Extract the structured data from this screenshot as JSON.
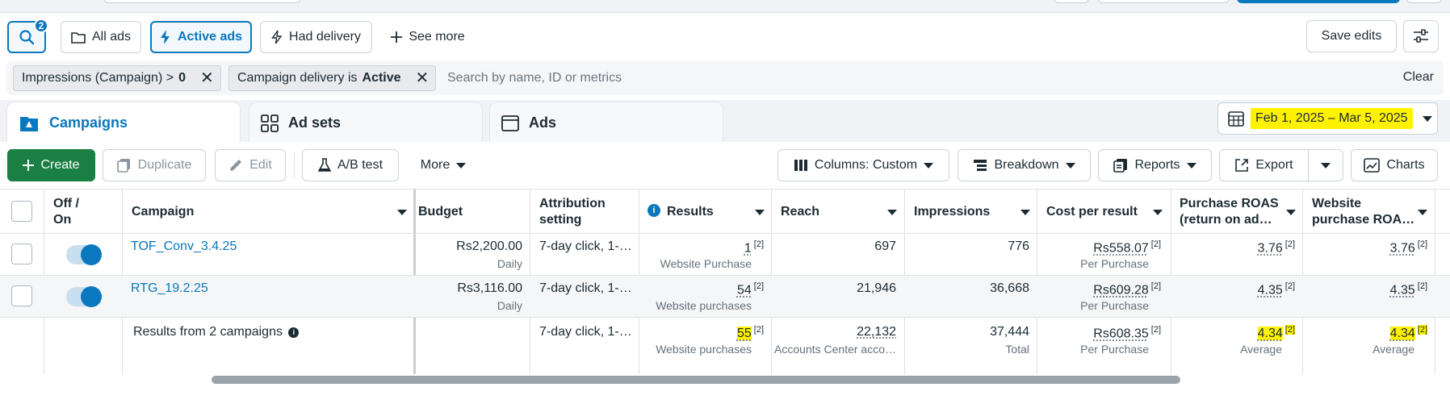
{
  "search": {
    "badge_count": "2"
  },
  "top_buttons": {
    "all_ads": "All ads",
    "active_ads": "Active ads",
    "had_delivery": "Had delivery",
    "see_more": "See more",
    "save_edits": "Save edits"
  },
  "filters": {
    "chip1_label": "Impressions (Campaign) >",
    "chip1_value": "0",
    "chip2_label": "Campaign delivery is",
    "chip2_value": "Active",
    "search_placeholder": "Search by name, ID or metrics",
    "clear": "Clear"
  },
  "tabs": [
    {
      "label": "Campaigns"
    },
    {
      "label": "Ad sets"
    },
    {
      "label": "Ads"
    }
  ],
  "date_range": "Feb 1, 2025 – Mar 5, 2025",
  "toolbar": {
    "create": "Create",
    "duplicate": "Duplicate",
    "edit": "Edit",
    "ab_test": "A/B test",
    "more": "More",
    "columns": "Columns: Custom",
    "breakdown": "Breakdown",
    "reports": "Reports",
    "export": "Export",
    "charts": "Charts"
  },
  "table": {
    "headers": {
      "off_on_1": "Off /",
      "off_on_2": "On",
      "campaign": "Campaign",
      "budget": "Budget",
      "attribution_1": "Attribution",
      "attribution_2": "setting",
      "results": "Results",
      "reach": "Reach",
      "impressions": "Impressions",
      "cost_per_result": "Cost per result",
      "purchase_roas_1": "Purchase ROAS",
      "purchase_roas_2": "(return on ad…",
      "website_roas_1": "Website",
      "website_roas_2": "purchase ROA…"
    },
    "rows": [
      {
        "campaign": "TOF_Conv_3.4.25",
        "budget": "Rs2,200.00",
        "budget_sub": "Daily",
        "attribution": "7-day click, 1-…",
        "results": "1",
        "results_sub": "Website Purchase",
        "reach": "697",
        "impressions": "776",
        "cost": "Rs558.07",
        "cost_sub": "Per Purchase",
        "purchase_roas": "3.76",
        "website_roas": "3.76",
        "sup": "[2]"
      },
      {
        "campaign": "RTG_19.2.25",
        "budget": "Rs3,116.00",
        "budget_sub": "Daily",
        "attribution": "7-day click, 1-…",
        "results": "54",
        "results_sub": "Website purchases",
        "reach": "21,946",
        "impressions": "36,668",
        "cost": "Rs609.28",
        "cost_sub": "Per Purchase",
        "purchase_roas": "4.35",
        "website_roas": "4.35",
        "sup": "[2]"
      }
    ],
    "totals": {
      "label": "Results from 2 campaigns",
      "attribution": "7-day click, 1-…",
      "results": "55",
      "results_sub": "Website purchases",
      "reach": "22,132",
      "reach_sub": "Accounts Center acco…",
      "impressions": "37,444",
      "impressions_sub": "Total",
      "cost": "Rs608.35",
      "cost_sub": "Per Purchase",
      "purchase_roas": "4.34",
      "purchase_roas_sub": "Average",
      "website_roas": "4.34",
      "website_roas_sub": "Average",
      "sup": "[2]"
    }
  },
  "colors": {
    "accent": "#0a78be",
    "create_green": "#1a7f42",
    "highlight": "#fff200"
  }
}
